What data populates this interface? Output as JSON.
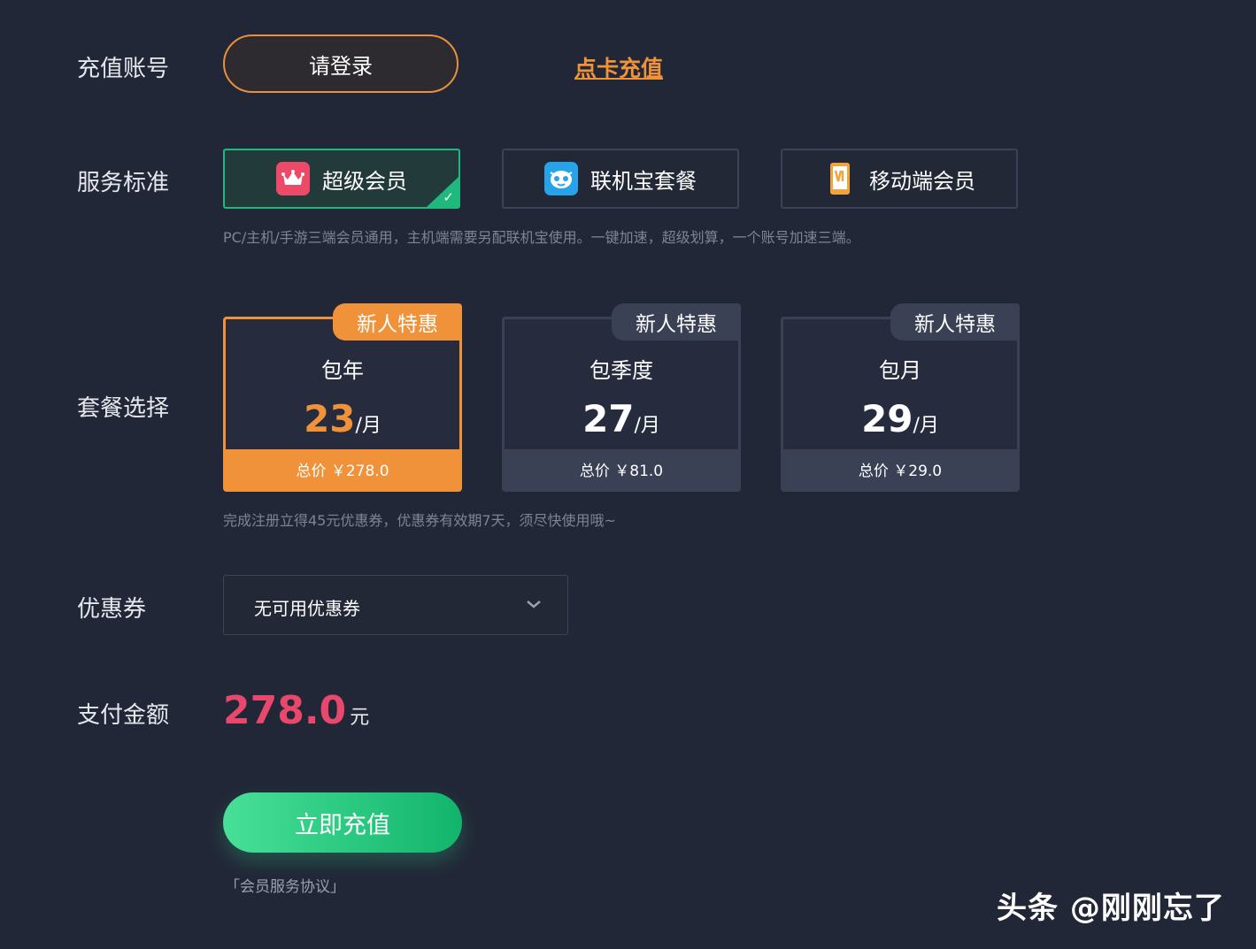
{
  "labels": {
    "account": "充值账号",
    "service": "服务标准",
    "plan": "套餐选择",
    "coupon": "优惠券",
    "amount": "支付金额"
  },
  "account": {
    "login_label": "请登录",
    "card_recharge_label": "点卡充值"
  },
  "services": [
    {
      "label": "超级会员",
      "icon": "crown-icon",
      "color": "#ec4a68",
      "active": true
    },
    {
      "label": "联机宝套餐",
      "icon": "mascot-icon",
      "color": "#27a3ea",
      "active": false
    },
    {
      "label": "移动端会员",
      "icon": "phone-icon",
      "color": "#f2a43c",
      "active": false
    }
  ],
  "service_desc": "PC/主机/手游三端会员通用，主机端需要另配联机宝使用。一键加速，超级划算，一个账号加速三端。",
  "plans": [
    {
      "tag": "新人特惠",
      "name": "包年",
      "price": "23",
      "unit": "/月",
      "total": "总价 ￥278.0",
      "active": true
    },
    {
      "tag": "新人特惠",
      "name": "包季度",
      "price": "27",
      "unit": "/月",
      "total": "总价 ￥81.0",
      "active": false
    },
    {
      "tag": "新人特惠",
      "name": "包月",
      "price": "29",
      "unit": "/月",
      "total": "总价 ￥29.0",
      "active": false
    }
  ],
  "plan_desc": "完成注册立得45元优惠券，优惠券有效期7天，须尽快使用哦~",
  "coupon": {
    "value": "无可用优惠券",
    "icon": "chevron-down-icon"
  },
  "amount": {
    "value": "278.0",
    "unit": "元"
  },
  "pay_label": "立即充值",
  "agreement_label": "「会员服务协议」",
  "watermark": "头条 @刚刚忘了",
  "colors": {
    "background": "#222737",
    "accent_orange": "#f0923a",
    "accent_green": "#1fb97d",
    "price_red": "#e8486c"
  }
}
